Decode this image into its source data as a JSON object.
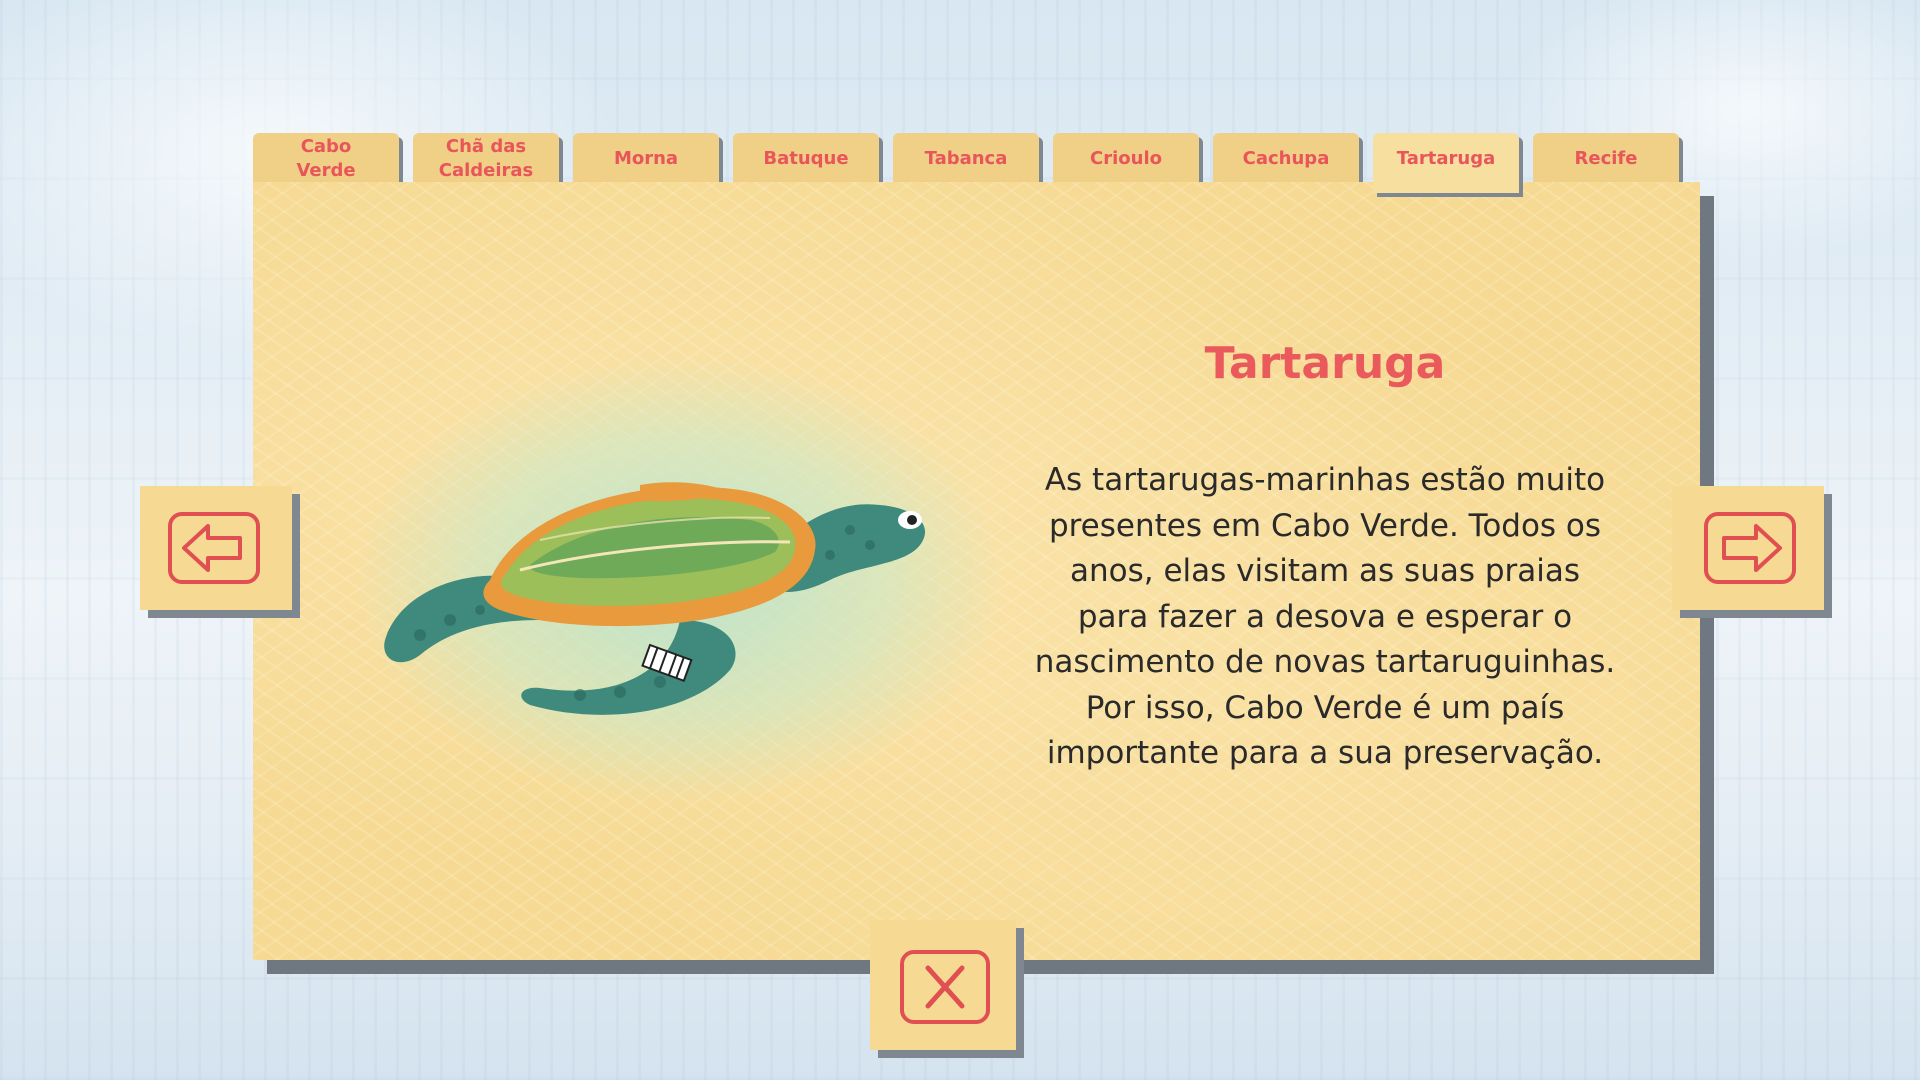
{
  "tabs": [
    {
      "label": "Cabo Verde",
      "active": false
    },
    {
      "label": "Chã das Caldeiras",
      "active": false
    },
    {
      "label": "Morna",
      "active": false
    },
    {
      "label": "Batuque",
      "active": false
    },
    {
      "label": "Tabanca",
      "active": false
    },
    {
      "label": "Crioulo",
      "active": false
    },
    {
      "label": "Cachupa",
      "active": false
    },
    {
      "label": "Tartaruga",
      "active": true
    },
    {
      "label": "Recife",
      "active": false
    }
  ],
  "content": {
    "title": "Tartaruga",
    "body": "As tartarugas-marinhas estão muito presentes em Cabo Verde. Todos os anos, elas visitam as suas praias para fazer a desova e esperar o nascimento de novas tartaruguinhas. Por isso, Cabo Verde é um país importante para a sua preservação.",
    "illustration": "sea-turtle"
  },
  "navigation": {
    "prev_icon": "arrow-left-icon",
    "next_icon": "arrow-right-icon",
    "close_icon": "close-icon"
  },
  "colors": {
    "accent": "#ea5a5c",
    "card": "#f6da94",
    "tab": "#f0cf86",
    "shadow": "#7f8790",
    "turtle_shell_orange": "#e89a3c",
    "turtle_skin": "#3f8a7c"
  }
}
